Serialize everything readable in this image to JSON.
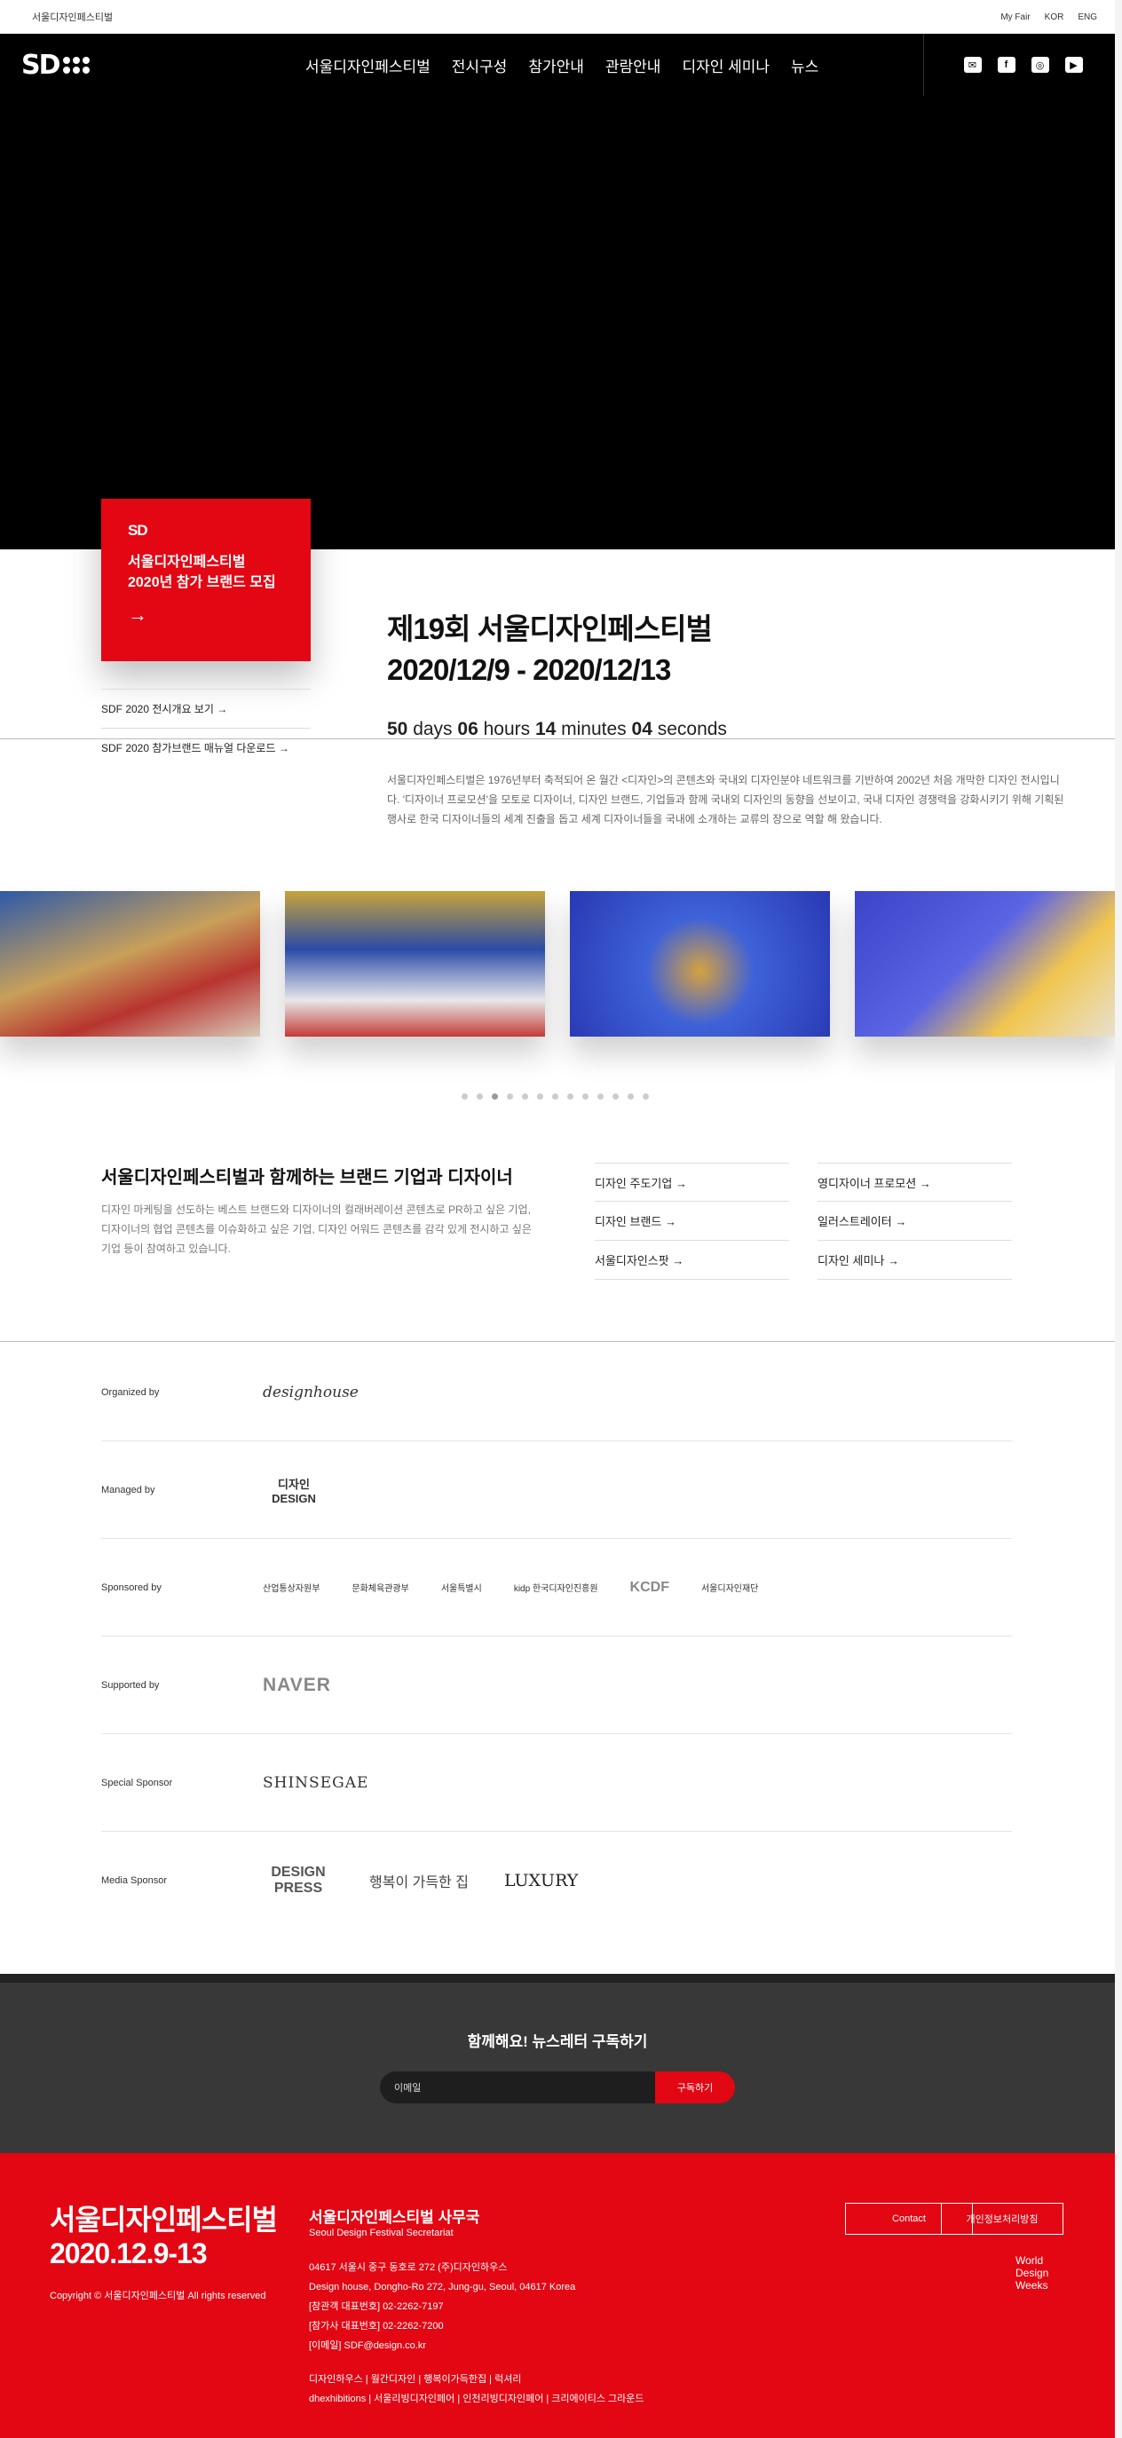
{
  "topbar": {
    "site_title": "서울디자인페스티벌",
    "links": [
      "My Fair",
      "KOR",
      "ENG"
    ]
  },
  "nav": {
    "logo_text": "SD",
    "menu": [
      "서울디자인페스티벌",
      "전시구성",
      "참가안내",
      "관람안내",
      "디자인 세미나",
      "뉴스"
    ],
    "social_icons": [
      "mail-icon",
      "facebook-icon",
      "instagram-icon",
      "youtube-icon"
    ]
  },
  "redcard": {
    "mini_logo": "SD",
    "title_line1": "서울디자인페스티벌",
    "title_line2": "2020년 참가 브랜드 모집",
    "arrow": "→"
  },
  "sidelinks": [
    "SDF 2020 전시개요 보기 →",
    "SDF 2020 참가브랜드 매뉴얼 다운로드 →"
  ],
  "hero": {
    "title_line1": "제19회 서울디자인페스티벌",
    "title_line2": "2020/12/9 - 2020/12/13",
    "countdown": {
      "days": "50",
      "days_label": " days ",
      "hours": "06",
      "hours_label": " hours ",
      "minutes": "14",
      "minutes_label": " minutes ",
      "seconds": "04",
      "seconds_label": " seconds"
    },
    "intro": "서울디자인페스티벌은 1976년부터 축적되어 온 월간 <디자인>의 콘텐츠와 국내외 디자인분야 네트워크를 기반하여 2002년 처음 개막한 디자인 전시입니다. '디자이너 프로모션'을 모토로 디자이너, 디자인 브랜드, 기업들과 함께 국내외 디자인의 동향을 선보이고, 국내 디자인 경쟁력을 강화시키기 위해 기획된 행사로 한국 디자이너들의 세계 진출을 돕고 세계 디자이너들을 국내에 소개하는 교류의 장으로 역할 해 왔습니다."
  },
  "carousel": {
    "slide_count": 13,
    "active_index": 2
  },
  "brands": {
    "title": "서울디자인페스티벌과 함께하는 브랜드 기업과 디자이너",
    "desc": "디자인 마케팅을 선도하는 베스트 브랜드와 디자이너의 컬래버레이션 콘텐츠로 PR하고 싶은 기업, 디자이너의 협업 콘텐츠를 이슈화하고 싶은 기업, 디자인 어워드 콘텐츠를 감각 있게 전시하고 싶은 기업 등이 참여하고 있습니다.",
    "links": [
      "디자인 주도기업 →",
      "영디자이너 프로모션 →",
      "디자인 브랜드 →",
      "일러스트레이터 →",
      "서울디자인스팟 →",
      "디자인 세미나 →"
    ]
  },
  "sponsors": [
    {
      "label": "Organized by",
      "logos": [
        "designhouse"
      ]
    },
    {
      "label": "Managed by",
      "logos": [
        "디자인 DESIGN"
      ]
    },
    {
      "label": "Sponsored by",
      "logos": [
        "산업통상자원부",
        "문화체육관광부",
        "서울특별시",
        "kidp 한국디자인진흥원",
        "KCDF",
        "서울디자인재단"
      ]
    },
    {
      "label": "Supported by",
      "logos": [
        "NAVER"
      ]
    },
    {
      "label": "Special Sponsor",
      "logos": [
        "SHINSEGAE"
      ]
    },
    {
      "label": "Media Sponsor",
      "logos": [
        "DESIGN PRESS",
        "행복이 가득한 집",
        "LUXURY"
      ]
    }
  ],
  "newsletter": {
    "heading": "함께해요! 뉴스레터 구독하기",
    "placeholder": "이메일",
    "button": "구독하기"
  },
  "footer": {
    "logo_line1": "서울디자인페스티벌",
    "logo_line2": "2020.12.9-13",
    "copyright": "Copyright © 서울디자인페스티벌 All rights reserved",
    "office": "서울디자인페스티벌 사무국",
    "office_en": "Seoul Design Festival Secretariat",
    "address": [
      "04617 서울시 중구 동호로 272 (주)디자인하우스",
      "Design house, Dongho-Ro 272, Jung-gu, Seoul, 04617 Korea",
      "[참관객 대표번호] 02-2262-7197",
      "[참가사 대표번호] 02-2262-7200",
      "[이메일] SDF@design.co.kr"
    ],
    "links": [
      "디자인하우스 | 월간디자인 | 행복이가득한집 | 럭셔리",
      "dhexhibitions | 서울리빙디자인페어 | 인천리빙디자인페어 | 크리에이티스 그라운드"
    ],
    "contact": "Contact",
    "privacy": "개인정보처리방침",
    "wdw": [
      "World",
      "Design",
      "Weeks"
    ]
  },
  "colors": {
    "brand_red": "#e30613",
    "dark": "#383838"
  }
}
